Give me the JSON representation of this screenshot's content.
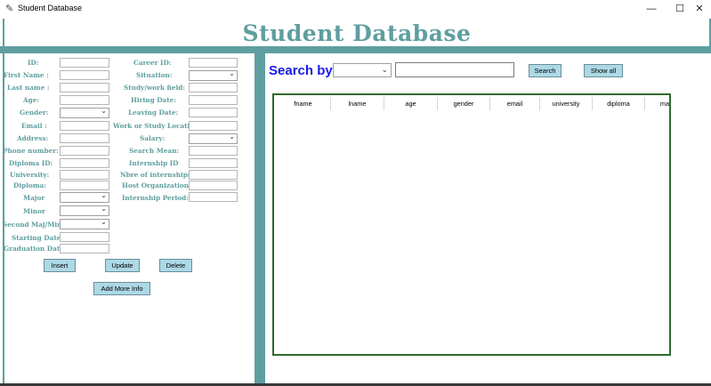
{
  "window": {
    "title": "Student Database",
    "icon": "feather-icon",
    "minimize": "—",
    "maximize": "☐",
    "close": "✕"
  },
  "banner": {
    "heading": "Student Database"
  },
  "colors": {
    "accent": "#5f9ea0",
    "button": "#add8e6",
    "search_label": "#1a1ae6",
    "table_border": "#2e6b2e"
  },
  "form": {
    "id_label": "ID:",
    "first_name_label": "First Name :",
    "last_name_label": "Last name :",
    "age_label": "Age:",
    "gender_label": "Gender:",
    "email_label": "Email :",
    "address_label": "Address:",
    "phone_label": "Phone number:",
    "diploma_id_label": "Diploma ID:",
    "university_label": "University:",
    "diploma_label": "Diploma:",
    "major_label": "Major",
    "minor_label": "Minor",
    "second_major_label": "Second Maj/Min",
    "starting_date_label": "Starting Date",
    "graduation_date_label": "Graduation Date",
    "career_id_label": "Career ID:",
    "situation_label": "Situation:",
    "study_field_label": "Study/work field:",
    "hiring_date_label": "Hiring Date:",
    "leaving_date_label": "Leaving Date:",
    "location_label": "Work or Study Location:",
    "salary_label": "Salary:",
    "search_mean_label": "Search Mean:",
    "internship_id_label": "Internship ID",
    "nbre_internship_label": "Nbre of internships:",
    "host_org_label": "Host Organization:",
    "internship_period_label": "Internship Period:"
  },
  "buttons": {
    "insert": "Insert",
    "update": "Update",
    "delete": "Delete",
    "add_more": "Add More Info"
  },
  "search": {
    "label": "Search by",
    "button": "Search",
    "show_all": "Show all",
    "query": "",
    "field": ""
  },
  "table": {
    "columns": [
      "fname",
      "lname",
      "age",
      "gender",
      "email",
      "university",
      "diploma",
      "ma"
    ],
    "rows": []
  }
}
